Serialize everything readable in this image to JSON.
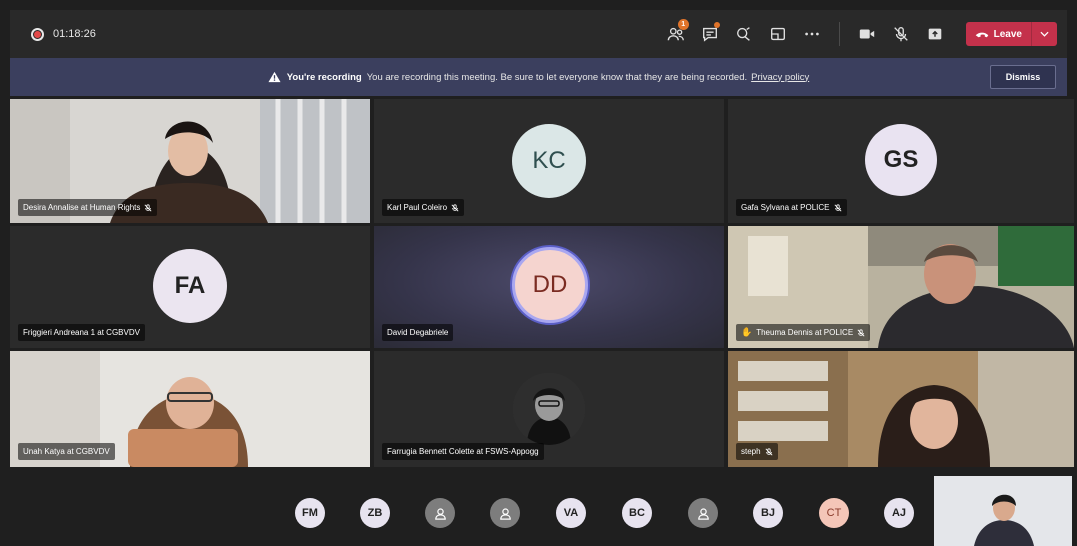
{
  "toolbar": {
    "timer": "01:18:26",
    "participants_badge": "1",
    "leave_label": "Leave"
  },
  "banner": {
    "title": "You're recording",
    "message": "You are recording this meeting. Be sure to let everyone know that they are being recorded.",
    "privacy_link": "Privacy policy",
    "dismiss_label": "Dismiss"
  },
  "tiles": [
    {
      "name": "Desira Annalise at Human Rights",
      "muted": true,
      "initials": ""
    },
    {
      "name": "Karl Paul Coleiro",
      "muted": true,
      "initials": "KC"
    },
    {
      "name": "Gafa Sylvana at POLICE",
      "muted": true,
      "initials": "GS"
    },
    {
      "name": "Friggieri Andreana 1 at CGBVDV",
      "muted": false,
      "initials": "FA"
    },
    {
      "name": "David Degabriele",
      "muted": false,
      "initials": "DD"
    },
    {
      "name": "Theuma Dennis at POLICE",
      "muted": true,
      "initials": ""
    },
    {
      "name": "Unah Katya at CGBVDV",
      "muted": false,
      "initials": ""
    },
    {
      "name": "Farrugia Bennett Colette at FSWS-Appogg",
      "muted": false,
      "initials": ""
    },
    {
      "name": "steph",
      "muted": true,
      "initials": ""
    }
  ],
  "roster": [
    {
      "initials": "FM",
      "type": "initials"
    },
    {
      "initials": "ZB",
      "type": "initials"
    },
    {
      "initials": "",
      "type": "person-icon"
    },
    {
      "initials": "",
      "type": "person-icon"
    },
    {
      "initials": "VA",
      "type": "initials"
    },
    {
      "initials": "BC",
      "type": "initials"
    },
    {
      "initials": "",
      "type": "person-icon"
    },
    {
      "initials": "BJ",
      "type": "initials"
    },
    {
      "initials": "CT",
      "type": "initials-pink"
    },
    {
      "initials": "AJ",
      "type": "initials"
    }
  ],
  "colors": {
    "leave": "#c4314b",
    "banner": "#3b3f5e",
    "badge": "#e0742a",
    "speaking_ring": "#5b5fc7"
  }
}
